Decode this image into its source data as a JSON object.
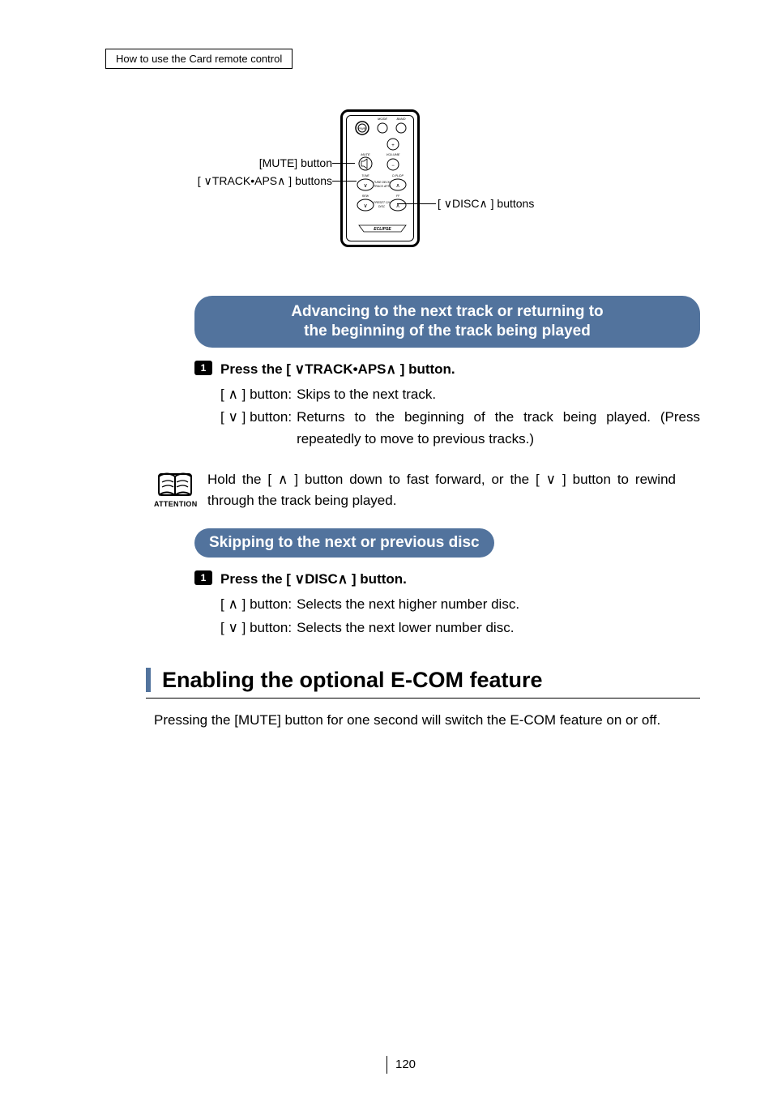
{
  "header": {
    "breadcrumb": "How to use the Card remote control"
  },
  "diagram": {
    "label_mute": "[MUTE] button",
    "label_track_prefix": "[ ",
    "label_track_core": "TRACK•APS",
    "label_track_suffix": " ] buttons",
    "label_disc_prefix": "[ ",
    "label_disc_core": "DISC",
    "label_disc_suffix": " ] buttons",
    "remote_text": {
      "mode": "MODE",
      "band": "BAND",
      "pwr": "PWR",
      "mute": "MUTE",
      "volume": "VOLUME",
      "tune": "TUNE",
      "dplp": "D-PL/DP",
      "tunedeck": "TUNE DECK",
      "trackaps": "TRACK APS",
      "rew": "REW",
      "ff": "FF",
      "preset": "PRESET CH",
      "disc": "DISC",
      "brand": "ECLIPSE"
    }
  },
  "section1": {
    "title_line1": "Advancing to the next track or returning to",
    "title_line2": "the beginning of the track being played",
    "step_num": "1",
    "step_a": "Press the [ ",
    "step_b": "TRACK•APS",
    "step_c": " ] button.",
    "row_up_key": "[     ] button:",
    "row_up_val": "Skips to the next track.",
    "row_dn_key": "[     ] button:",
    "row_dn_val": "Returns to the beginning of the track being played. (Press repeatedly to move to previous tracks.)"
  },
  "attention": {
    "label": "ATTENTION",
    "text_a": "Hold the [ ",
    "text_b": " ] button down to fast forward, or the [ ",
    "text_c": " ] button to rewind through the track being played."
  },
  "section2": {
    "title": "Skipping to the next or previous disc",
    "step_num": "1",
    "step_a": "Press the [ ",
    "step_b": "DISC",
    "step_c": " ] button.",
    "row_up_key": "[     ] button:",
    "row_up_val": "Selects the next higher number disc.",
    "row_dn_key": "[     ] button:",
    "row_dn_val": "Selects the next lower number disc."
  },
  "h2": {
    "text": "Enabling the optional E-COM feature"
  },
  "para": {
    "text": "Pressing the [MUTE] button for one second will switch the E-COM feature on or off."
  },
  "footer": {
    "page": "120"
  },
  "glyph": {
    "up": "∧",
    "down": "∨"
  }
}
